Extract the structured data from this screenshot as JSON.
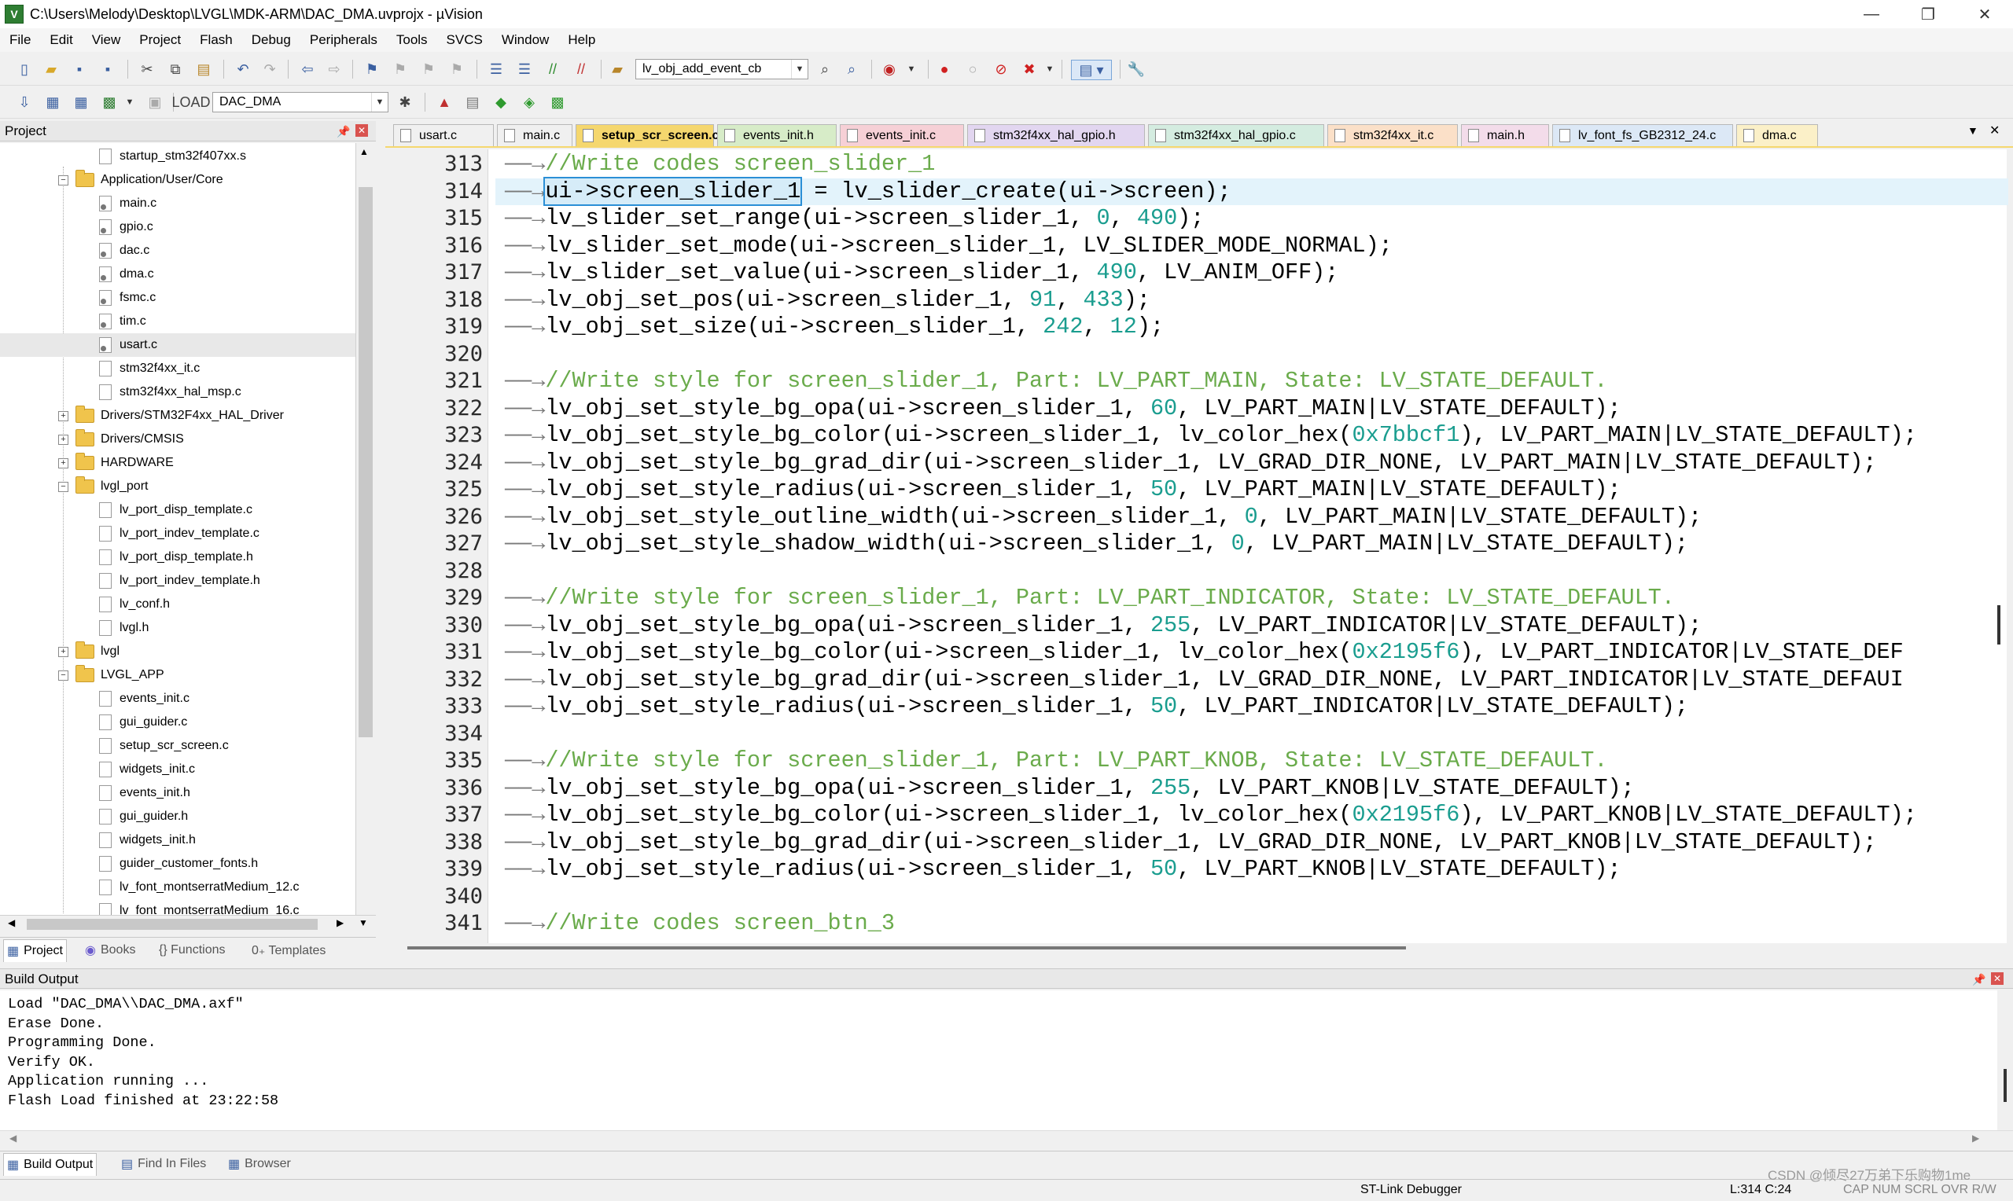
{
  "window": {
    "title": "C:\\Users\\Melody\\Desktop\\LVGL\\MDK-ARM\\DAC_DMA.uvprojx - µVision",
    "minimize": "—",
    "maximize": "❐",
    "close": "✕"
  },
  "menu": [
    "File",
    "Edit",
    "View",
    "Project",
    "Flash",
    "Debug",
    "Peripherals",
    "Tools",
    "SVCS",
    "Window",
    "Help"
  ],
  "toolbar": {
    "find_combo_value": "lv_obj_add_event_cb",
    "target_combo_value": "DAC_DMA"
  },
  "project_panel": {
    "title": "Project",
    "tree": [
      {
        "label": "startup_stm32f407xx.s",
        "type": "file",
        "depth": 2
      },
      {
        "label": "Application/User/Core",
        "type": "folder",
        "depth": 1,
        "expanded": true
      },
      {
        "label": "main.c",
        "type": "file-key",
        "depth": 2
      },
      {
        "label": "gpio.c",
        "type": "file-key",
        "depth": 2
      },
      {
        "label": "dac.c",
        "type": "file-key",
        "depth": 2
      },
      {
        "label": "dma.c",
        "type": "file-key",
        "depth": 2
      },
      {
        "label": "fsmc.c",
        "type": "file-key",
        "depth": 2
      },
      {
        "label": "tim.c",
        "type": "file-key",
        "depth": 2
      },
      {
        "label": "usart.c",
        "type": "file-key",
        "depth": 2,
        "selected": true
      },
      {
        "label": "stm32f4xx_it.c",
        "type": "file",
        "depth": 2
      },
      {
        "label": "stm32f4xx_hal_msp.c",
        "type": "file",
        "depth": 2
      },
      {
        "label": "Drivers/STM32F4xx_HAL_Driver",
        "type": "folder",
        "depth": 1,
        "expanded": false
      },
      {
        "label": "Drivers/CMSIS",
        "type": "folder",
        "depth": 1,
        "expanded": false
      },
      {
        "label": "HARDWARE",
        "type": "folder",
        "depth": 1,
        "expanded": false
      },
      {
        "label": "lvgl_port",
        "type": "folder",
        "depth": 1,
        "expanded": true
      },
      {
        "label": "lv_port_disp_template.c",
        "type": "file",
        "depth": 2
      },
      {
        "label": "lv_port_indev_template.c",
        "type": "file",
        "depth": 2
      },
      {
        "label": "lv_port_disp_template.h",
        "type": "file",
        "depth": 2
      },
      {
        "label": "lv_port_indev_template.h",
        "type": "file",
        "depth": 2
      },
      {
        "label": "lv_conf.h",
        "type": "file",
        "depth": 2
      },
      {
        "label": "lvgl.h",
        "type": "file",
        "depth": 2
      },
      {
        "label": "lvgl",
        "type": "folder",
        "depth": 1,
        "expanded": false
      },
      {
        "label": "LVGL_APP",
        "type": "folder",
        "depth": 1,
        "expanded": true
      },
      {
        "label": "events_init.c",
        "type": "file",
        "depth": 2
      },
      {
        "label": "gui_guider.c",
        "type": "file",
        "depth": 2
      },
      {
        "label": "setup_scr_screen.c",
        "type": "file",
        "depth": 2
      },
      {
        "label": "widgets_init.c",
        "type": "file",
        "depth": 2
      },
      {
        "label": "events_init.h",
        "type": "file",
        "depth": 2
      },
      {
        "label": "gui_guider.h",
        "type": "file",
        "depth": 2
      },
      {
        "label": "widgets_init.h",
        "type": "file",
        "depth": 2
      },
      {
        "label": "guider_customer_fonts.h",
        "type": "file",
        "depth": 2
      },
      {
        "label": "lv_font_montserratMedium_12.c",
        "type": "file",
        "depth": 2
      },
      {
        "label": "lv_font_montserratMedium_16.c",
        "type": "file",
        "depth": 2
      }
    ],
    "tabs": [
      "Project",
      "Books",
      "{} Functions",
      "0₊ Templates"
    ]
  },
  "editor_tabs": [
    {
      "label": "usart.c",
      "color": "#f0f0f0",
      "active": false
    },
    {
      "label": "main.c",
      "color": "#f0f0f0",
      "active": false
    },
    {
      "label": "setup_scr_screen.c",
      "color": "#f5d76e",
      "active": true
    },
    {
      "label": "events_init.h",
      "color": "#d7ecc8",
      "active": false
    },
    {
      "label": "events_init.c",
      "color": "#f6d0d6",
      "active": false
    },
    {
      "label": "stm32f4xx_hal_gpio.h",
      "color": "#e2d6f0",
      "active": false
    },
    {
      "label": "stm32f4xx_hal_gpio.c",
      "color": "#d4ece0",
      "active": false
    },
    {
      "label": "stm32f4xx_it.c",
      "color": "#fbe0c8",
      "active": false
    },
    {
      "label": "main.h",
      "color": "#f3dcea",
      "active": false
    },
    {
      "label": "lv_font_fs_GB2312_24.c",
      "color": "#dce8f6",
      "active": false
    },
    {
      "label": "dma.c",
      "color": "#fbf0c8",
      "active": false
    }
  ],
  "code": {
    "tab_arrow": "——→",
    "lines": [
      {
        "n": "313",
        "text": "//Write codes screen_slider_1",
        "kind": "comment"
      },
      {
        "n": "314",
        "pre": "",
        "box": "ui->screen_slider_1",
        "post": " = lv_slider_create(ui->screen);",
        "kind": "current"
      },
      {
        "n": "315",
        "text": "lv_slider_set_range(ui->screen_slider_1, 0, 490);",
        "kind": "code"
      },
      {
        "n": "316",
        "text": "lv_slider_set_mode(ui->screen_slider_1, LV_SLIDER_MODE_NORMAL);",
        "kind": "code"
      },
      {
        "n": "317",
        "text": "lv_slider_set_value(ui->screen_slider_1, 490, LV_ANIM_OFF);",
        "kind": "code"
      },
      {
        "n": "318",
        "text": "lv_obj_set_pos(ui->screen_slider_1, 91, 433);",
        "kind": "code"
      },
      {
        "n": "319",
        "text": "lv_obj_set_size(ui->screen_slider_1, 242, 12);",
        "kind": "code"
      },
      {
        "n": "320",
        "text": "",
        "kind": "blank"
      },
      {
        "n": "321",
        "text": "//Write style for screen_slider_1, Part: LV_PART_MAIN, State: LV_STATE_DEFAULT.",
        "kind": "comment"
      },
      {
        "n": "322",
        "text": "lv_obj_set_style_bg_opa(ui->screen_slider_1, 60, LV_PART_MAIN|LV_STATE_DEFAULT);",
        "kind": "code"
      },
      {
        "n": "323",
        "text": "lv_obj_set_style_bg_color(ui->screen_slider_1, lv_color_hex(0x7bbcf1), LV_PART_MAIN|LV_STATE_DEFAULT);",
        "kind": "code"
      },
      {
        "n": "324",
        "text": "lv_obj_set_style_bg_grad_dir(ui->screen_slider_1, LV_GRAD_DIR_NONE, LV_PART_MAIN|LV_STATE_DEFAULT);",
        "kind": "code"
      },
      {
        "n": "325",
        "text": "lv_obj_set_style_radius(ui->screen_slider_1, 50, LV_PART_MAIN|LV_STATE_DEFAULT);",
        "kind": "code"
      },
      {
        "n": "326",
        "text": "lv_obj_set_style_outline_width(ui->screen_slider_1, 0, LV_PART_MAIN|LV_STATE_DEFAULT);",
        "kind": "code"
      },
      {
        "n": "327",
        "text": "lv_obj_set_style_shadow_width(ui->screen_slider_1, 0, LV_PART_MAIN|LV_STATE_DEFAULT);",
        "kind": "code"
      },
      {
        "n": "328",
        "text": "",
        "kind": "blank"
      },
      {
        "n": "329",
        "text": "//Write style for screen_slider_1, Part: LV_PART_INDICATOR, State: LV_STATE_DEFAULT.",
        "kind": "comment"
      },
      {
        "n": "330",
        "text": "lv_obj_set_style_bg_opa(ui->screen_slider_1, 255, LV_PART_INDICATOR|LV_STATE_DEFAULT);",
        "kind": "code"
      },
      {
        "n": "331",
        "text": "lv_obj_set_style_bg_color(ui->screen_slider_1, lv_color_hex(0x2195f6), LV_PART_INDICATOR|LV_STATE_DEF",
        "kind": "code"
      },
      {
        "n": "332",
        "text": "lv_obj_set_style_bg_grad_dir(ui->screen_slider_1, LV_GRAD_DIR_NONE, LV_PART_INDICATOR|LV_STATE_DEFAUI",
        "kind": "code"
      },
      {
        "n": "333",
        "text": "lv_obj_set_style_radius(ui->screen_slider_1, 50, LV_PART_INDICATOR|LV_STATE_DEFAULT);",
        "kind": "code"
      },
      {
        "n": "334",
        "text": "",
        "kind": "blank"
      },
      {
        "n": "335",
        "text": "//Write style for screen_slider_1, Part: LV_PART_KNOB, State: LV_STATE_DEFAULT.",
        "kind": "comment"
      },
      {
        "n": "336",
        "text": "lv_obj_set_style_bg_opa(ui->screen_slider_1, 255, LV_PART_KNOB|LV_STATE_DEFAULT);",
        "kind": "code"
      },
      {
        "n": "337",
        "text": "lv_obj_set_style_bg_color(ui->screen_slider_1, lv_color_hex(0x2195f6), LV_PART_KNOB|LV_STATE_DEFAULT);",
        "kind": "code"
      },
      {
        "n": "338",
        "text": "lv_obj_set_style_bg_grad_dir(ui->screen_slider_1, LV_GRAD_DIR_NONE, LV_PART_KNOB|LV_STATE_DEFAULT);",
        "kind": "code"
      },
      {
        "n": "339",
        "text": "lv_obj_set_style_radius(ui->screen_slider_1, 50, LV_PART_KNOB|LV_STATE_DEFAULT);",
        "kind": "code"
      },
      {
        "n": "340",
        "text": "",
        "kind": "blank"
      },
      {
        "n": "341",
        "text": "//Write codes screen_btn_3",
        "kind": "comment"
      }
    ]
  },
  "build_output": {
    "title": "Build Output",
    "lines": [
      "Load \"DAC_DMA\\\\DAC_DMA.axf\"",
      "Erase Done.",
      "Programming Done.",
      "Verify OK.",
      "Application running ...",
      "Flash Load finished at 23:22:58"
    ],
    "tabs": [
      "Build Output",
      "Find In Files",
      "Browser"
    ]
  },
  "status": {
    "debugger": "ST-Link Debugger",
    "position": "L:314 C:24",
    "indicators": "CAP  NUM  SCRL  OVR  R/W",
    "watermark": "CSDN @倾尽27万弟下乐购物1me"
  },
  "colors": {
    "comment": "#6aab4b",
    "number": "#1a9d8f",
    "current_line": "#e3f3fb",
    "active_tab": "#f5d76e"
  }
}
